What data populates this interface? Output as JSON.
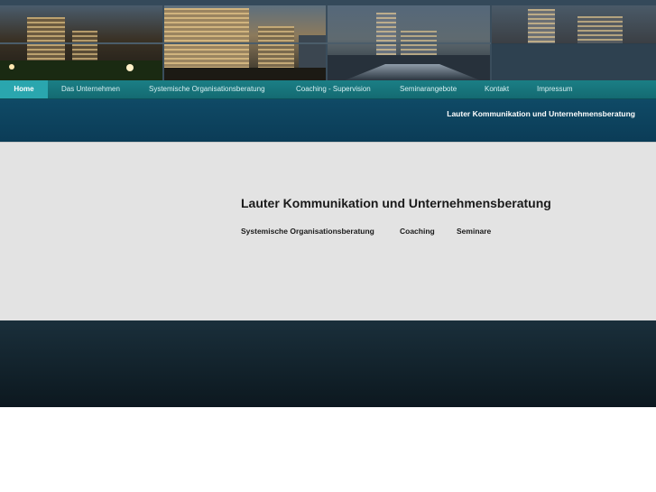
{
  "nav": {
    "items": [
      {
        "label": "Home",
        "active": true
      },
      {
        "label": "Das Unternehmen",
        "active": false
      },
      {
        "label": "Systemische Organisationsberatung",
        "active": false
      },
      {
        "label": "Coaching - Supervision",
        "active": false
      },
      {
        "label": "Seminarangebote",
        "active": false
      },
      {
        "label": "Kontakt",
        "active": false
      },
      {
        "label": "Impressum",
        "active": false
      }
    ]
  },
  "band": {
    "title": "Lauter Kommunikation und Unternehmensberatung"
  },
  "main": {
    "title": "Lauter Kommunikation und Unternehmensberatung",
    "links": [
      {
        "label": "Systemische Organisationsberatung"
      },
      {
        "label": "Coaching"
      },
      {
        "label": "Seminare"
      }
    ]
  },
  "colors": {
    "nav_bg": "#167379",
    "nav_active": "#2aa6ae",
    "band_bg": "#0e4561",
    "content_bg": "#e3e3e3",
    "footer_bg": "#122530"
  }
}
